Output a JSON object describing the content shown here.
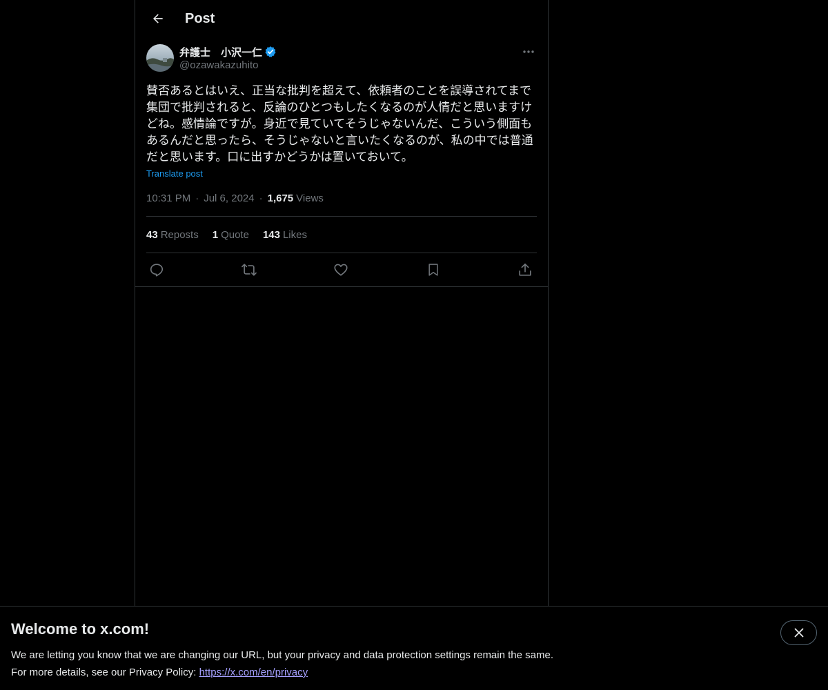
{
  "header": {
    "title": "Post"
  },
  "post": {
    "author_name": "弁護士　小沢一仁",
    "author_handle": "@ozawakazuhito",
    "text": "賛否あるとはいえ、正当な批判を超えて、依頼者のことを誤導されてまで集団で批判されると、反論のひとつもしたくなるのが人情だと思いますけどね。感情論ですが。身近で見ていてそうじゃないんだ、こういう側面もあるんだと思ったら、そうじゃないと言いたくなるのが、私の中では普通だと思います。口に出すかどうかは置いておいて。",
    "translate_label": "Translate post",
    "time": "10:31 PM",
    "date": "Jul 6, 2024",
    "views_count": "1,675",
    "views_label": "Views"
  },
  "stats": {
    "reposts_count": "43",
    "reposts_label": "Reposts",
    "quotes_count": "1",
    "quotes_label": "Quote",
    "likes_count": "143",
    "likes_label": "Likes"
  },
  "banner": {
    "title": "Welcome to x.com!",
    "line1": "We are letting you know that we are changing our URL, but your privacy and data protection settings remain the same.",
    "line2_prefix": "For more details, see our Privacy Policy: ",
    "link_text": "https://x.com/en/privacy"
  },
  "icons": {
    "back": "arrow-left-icon",
    "verified": "verified-badge-icon",
    "more": "more-horizontal-icon",
    "reply": "reply-icon",
    "repost": "repost-icon",
    "like": "heart-icon",
    "bookmark": "bookmark-icon",
    "share": "share-icon",
    "close": "close-icon"
  },
  "colors": {
    "background": "#000000",
    "accent": "#1d9bf0",
    "text": "#e7e9ea",
    "muted": "#71767b",
    "border": "#2f3336",
    "link": "#a5a0ff"
  }
}
